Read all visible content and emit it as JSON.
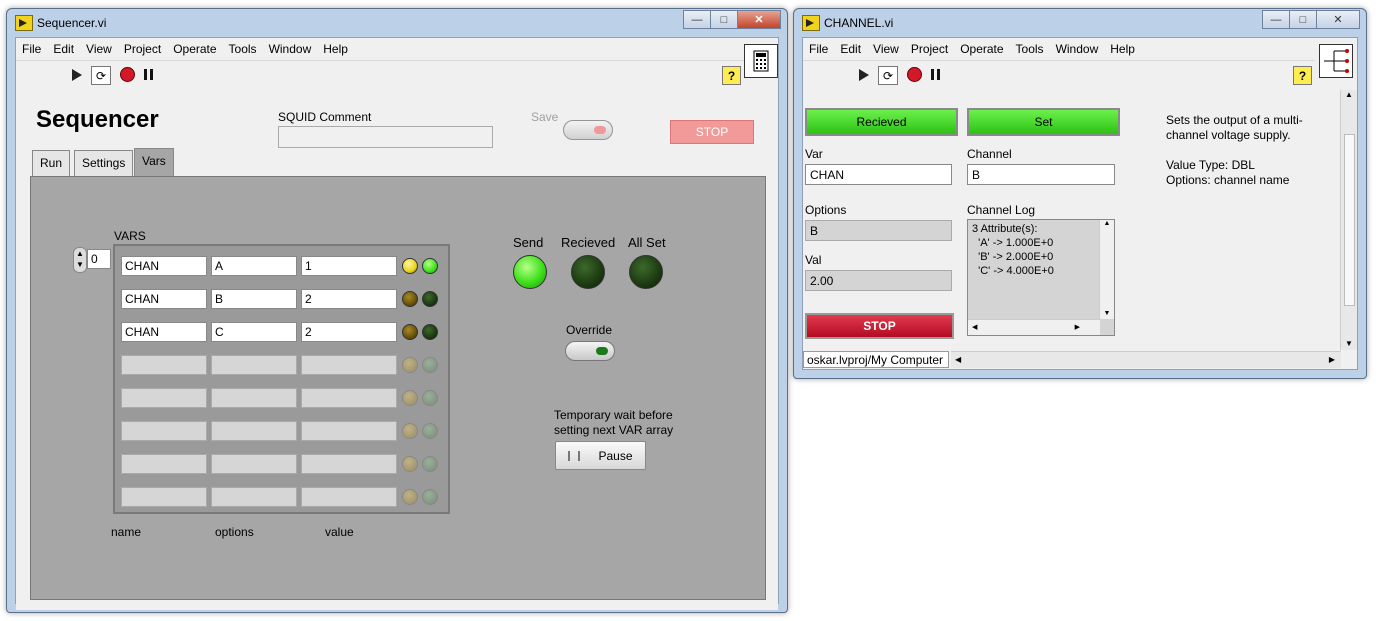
{
  "menu": [
    "File",
    "Edit",
    "View",
    "Project",
    "Operate",
    "Tools",
    "Window",
    "Help"
  ],
  "seq": {
    "title": "Sequencer.vi",
    "heading": "Sequencer",
    "squid_label": "SQUID Comment",
    "squid_value": "",
    "save_label": "Save",
    "stop_label": "STOP",
    "tabs": [
      "Run",
      "Settings",
      "Vars"
    ],
    "vars_label": "VARS",
    "index": "0",
    "rows": [
      {
        "name": "CHAN",
        "option": "A",
        "value": "1"
      },
      {
        "name": "CHAN",
        "option": "B",
        "value": "2"
      },
      {
        "name": "CHAN",
        "option": "C",
        "value": "2"
      },
      {
        "name": "",
        "option": "",
        "value": ""
      },
      {
        "name": "",
        "option": "",
        "value": ""
      },
      {
        "name": "",
        "option": "",
        "value": ""
      },
      {
        "name": "",
        "option": "",
        "value": ""
      },
      {
        "name": "",
        "option": "",
        "value": ""
      }
    ],
    "col_labels": [
      "name",
      "options",
      "value"
    ],
    "send_label": "Send",
    "recieved_label": "Recieved",
    "allset_label": "All Set",
    "override_label": "Override",
    "wait_label_1": "Temporary wait before",
    "wait_label_2": "setting next VAR array",
    "pause_label": "Pause"
  },
  "chan": {
    "title": "CHANNEL.vi",
    "recieved_label": "Recieved",
    "set_label": "Set",
    "var_label": "Var",
    "var_value": "CHAN",
    "channel_label": "Channel",
    "channel_value": "B",
    "options_label": "Options",
    "options_value": "B",
    "val_label": "Val",
    "val_value": "2.00",
    "stop_label": "STOP",
    "log_label": "Channel Log",
    "log_lines": [
      "3 Attribute(s):",
      "  'A' -> 1.000E+0",
      "  'B' -> 2.000E+0",
      "  'C' -> 4.000E+0"
    ],
    "desc_1": "Sets the output of a multi-",
    "desc_2": "channel voltage supply.",
    "desc_3": "Value Type: DBL",
    "desc_4": "Options: channel name",
    "status_path": "oskar.lvproj/My Computer"
  },
  "colors": {
    "led_green_on": "#3ee01a",
    "led_off": "#1d3a12",
    "button_green": "#36d420",
    "stop_red": "#c8102e",
    "stop_pink": "#f29a9a"
  }
}
